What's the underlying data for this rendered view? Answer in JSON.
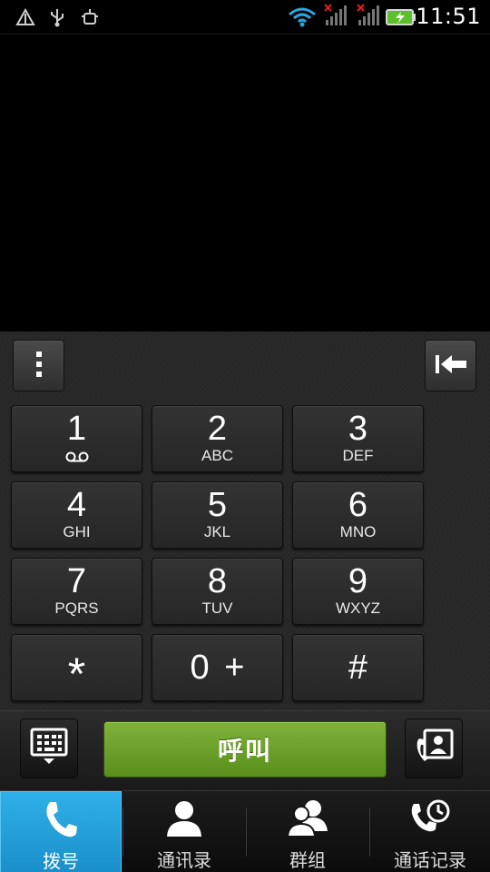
{
  "status_bar": {
    "time": "11:51",
    "icons": [
      "alert-icon",
      "usb-icon",
      "android-debug-icon",
      "wifi-icon",
      "signal-no-service-icon",
      "signal-no-service-icon-2",
      "battery-charging-icon"
    ]
  },
  "dialer": {
    "menu_icon": "more-vert-icon",
    "backspace_icon": "backspace-icon",
    "keys": [
      {
        "digit": "1",
        "letters": ""
      },
      {
        "digit": "2",
        "letters": "ABC"
      },
      {
        "digit": "3",
        "letters": "DEF"
      },
      {
        "digit": "4",
        "letters": "GHI"
      },
      {
        "digit": "5",
        "letters": "JKL"
      },
      {
        "digit": "6",
        "letters": "MNO"
      },
      {
        "digit": "7",
        "letters": "PQRS"
      },
      {
        "digit": "8",
        "letters": "TUV"
      },
      {
        "digit": "9",
        "letters": "WXYZ"
      },
      {
        "digit": "*",
        "letters": ""
      },
      {
        "digit": "0 +",
        "letters": ""
      },
      {
        "digit": "#",
        "letters": ""
      }
    ]
  },
  "action_row": {
    "call_label": "呼叫",
    "keypad_toggle_icon": "keypad-hide-icon",
    "add_contact_icon": "contact-card-icon"
  },
  "tabs": [
    {
      "label": "拨号",
      "icon": "phone-icon",
      "active": true
    },
    {
      "label": "通讯录",
      "icon": "person-icon",
      "active": false
    },
    {
      "label": "群组",
      "icon": "group-icon",
      "active": false
    },
    {
      "label": "通话记录",
      "icon": "call-history-icon",
      "active": false
    }
  ],
  "colors": {
    "accent_tab": "#2fb0e8",
    "call_green": "#6aa02a",
    "battery_green": "#5cc02a"
  }
}
